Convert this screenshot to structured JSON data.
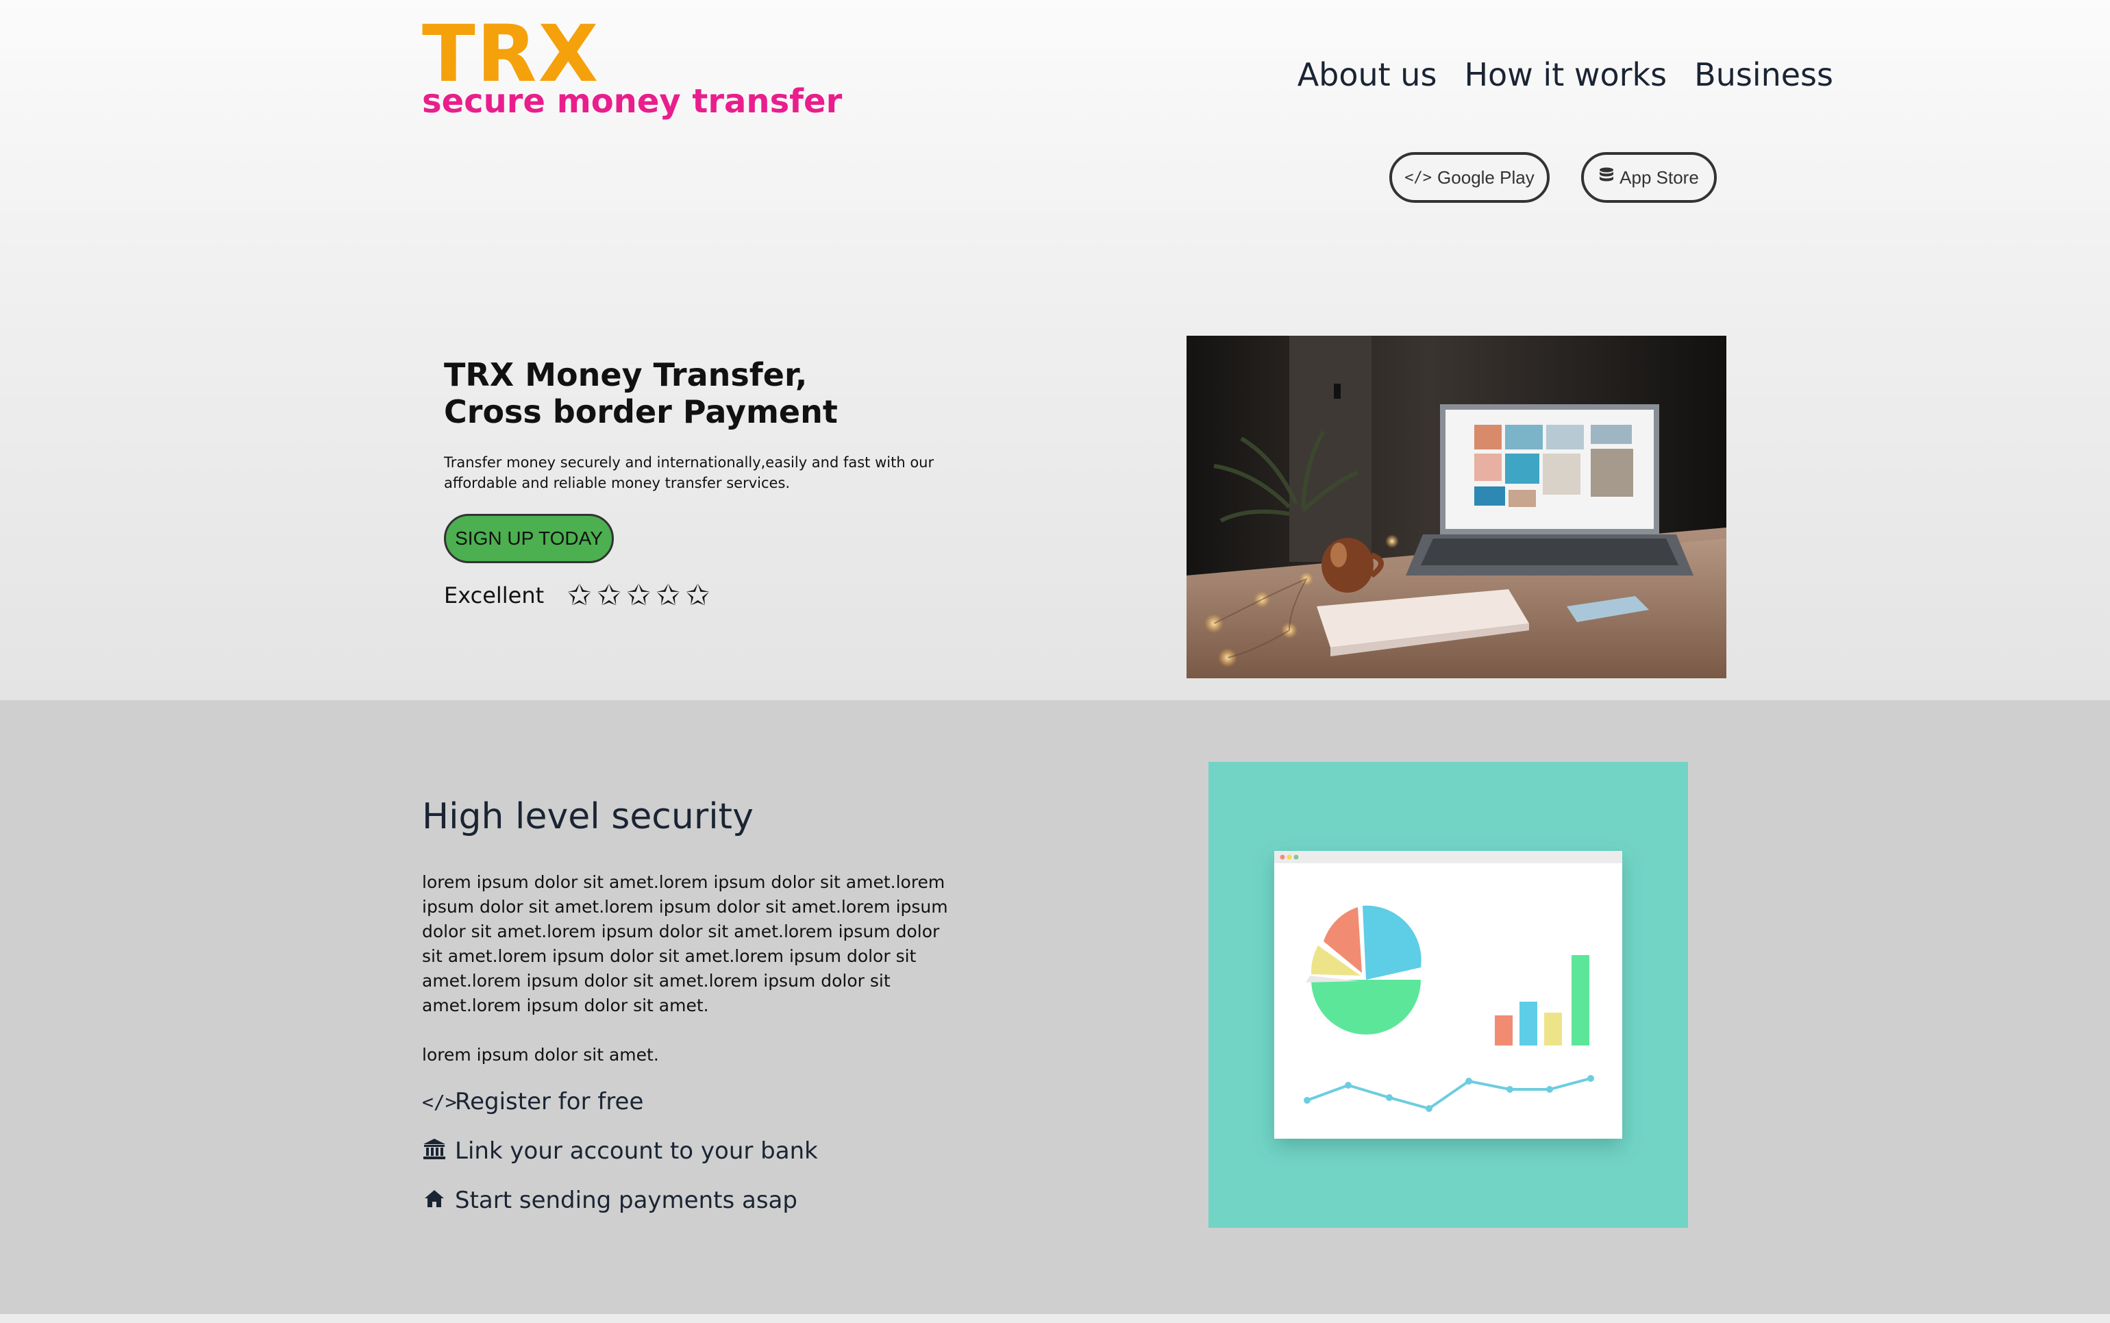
{
  "brand": {
    "name": "TRX",
    "tagline": "secure money transfer"
  },
  "nav": {
    "items": [
      "About us",
      "How it works",
      "Business"
    ]
  },
  "store_buttons": {
    "google_play": "Google Play",
    "app_store": "App Store"
  },
  "hero": {
    "title_line1": "TRX Money Transfer,",
    "title_line2": "Cross border Payment",
    "description": "Transfer money securely and internationally,easily and fast with our affordable and reliable money transfer services.",
    "cta": "SIGN UP TODAY",
    "rating_label": "Excellent",
    "stars": 5
  },
  "features": {
    "title": "High level security",
    "paragraph1": "lorem ipsum dolor sit amet.lorem ipsum dolor sit amet.lorem ipsum dolor sit amet.lorem ipsum dolor sit amet.lorem ipsum dolor sit amet.lorem ipsum dolor sit amet.lorem ipsum dolor sit amet.lorem ipsum dolor sit amet.lorem ipsum dolor sit amet.lorem ipsum dolor sit amet.lorem ipsum dolor sit amet.lorem ipsum dolor sit amet.",
    "paragraph2": "lorem ipsum dolor sit amet.",
    "steps": [
      {
        "icon": "code-icon",
        "label": "Register for free"
      },
      {
        "icon": "bank-icon",
        "label": "Link your account to your bank"
      },
      {
        "icon": "home-icon",
        "label": "Start sending payments asap"
      }
    ]
  },
  "colors": {
    "brand_orange": "#f5a10c",
    "brand_pink": "#e91e8c",
    "cta_green": "#4caf50",
    "illustration_teal": "#72d4c5"
  }
}
